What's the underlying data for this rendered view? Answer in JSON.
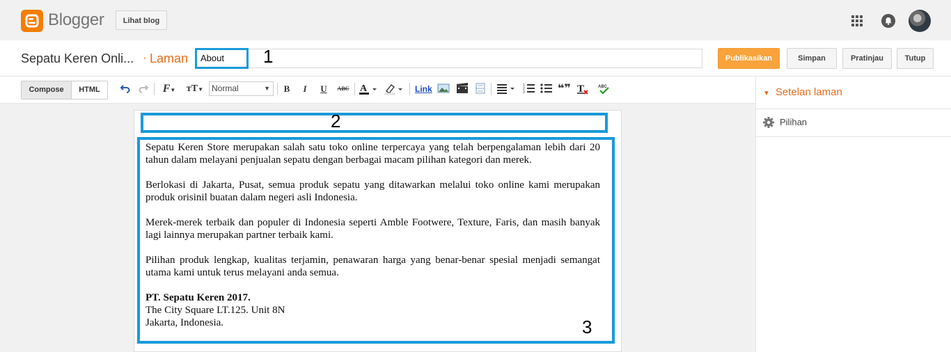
{
  "header": {
    "app_name": "Blogger",
    "view_blog_label": "Lihat blog",
    "icons": [
      "blogger-logo-icon",
      "apps-grid-icon",
      "notifications-icon",
      "avatar"
    ]
  },
  "title_row": {
    "blog_name": "Sepatu Keren Onli...",
    "separator": "·",
    "section": "Laman",
    "page_title_value": "About",
    "buttons": {
      "publish": "Publikasikan",
      "save": "Simpan",
      "preview": "Pratinjau",
      "close": "Tutup"
    }
  },
  "annotations": {
    "one": "1",
    "two": "2",
    "three": "3"
  },
  "toolbar": {
    "compose_label": "Compose",
    "html_label": "HTML",
    "format_value": "Normal",
    "bold": "B",
    "italic": "I",
    "underline": "U",
    "strike": "ABC",
    "link_label": "Link",
    "quote": "❝❞",
    "icons": [
      "undo-icon",
      "redo-icon",
      "font-family-icon",
      "font-size-icon",
      "text-color-icon",
      "highlight-color-icon",
      "image-icon",
      "video-icon",
      "jump-break-icon",
      "align-icon",
      "numbered-list-icon",
      "bullet-list-icon",
      "quote-icon",
      "clear-formatting-icon",
      "spell-check-icon"
    ]
  },
  "sidebar": {
    "settings_title": "Setelan laman",
    "options_label": "Pilihan"
  },
  "content": {
    "p1": "Sepatu Keren Store merupakan salah satu toko online terpercaya yang telah berpengalaman lebih dari 20 tahun dalam melayani penjualan sepatu dengan berbagai macam pilihan kategori dan merek.",
    "p2": "Berlokasi di Jakarta, Pusat, semua produk sepatu yang ditawarkan melalui toko online kami merupakan produk orisinil buatan dalam negeri asli Indonesia.",
    "p3": "Merek-merek terbaik dan populer di Indonesia seperti Amble Footwere, Texture, Faris, dan masih banyak lagi lainnya merupakan partner terbaik kami.",
    "p4": "Pilihan produk lengkap, kualitas terjamin, penawaran harga yang benar-benar spesial menjadi semangat utama kami untuk terus melayani anda semua.",
    "company": "PT. Sepatu Keren 2017.",
    "address1": "The City Square LT.125. Unit 8N",
    "address2": "Jakarta, Indonesia."
  },
  "colors": {
    "accent_orange": "#e66c1e",
    "publish_orange": "#f8a33b",
    "annotation_blue": "#1a9ad9"
  }
}
